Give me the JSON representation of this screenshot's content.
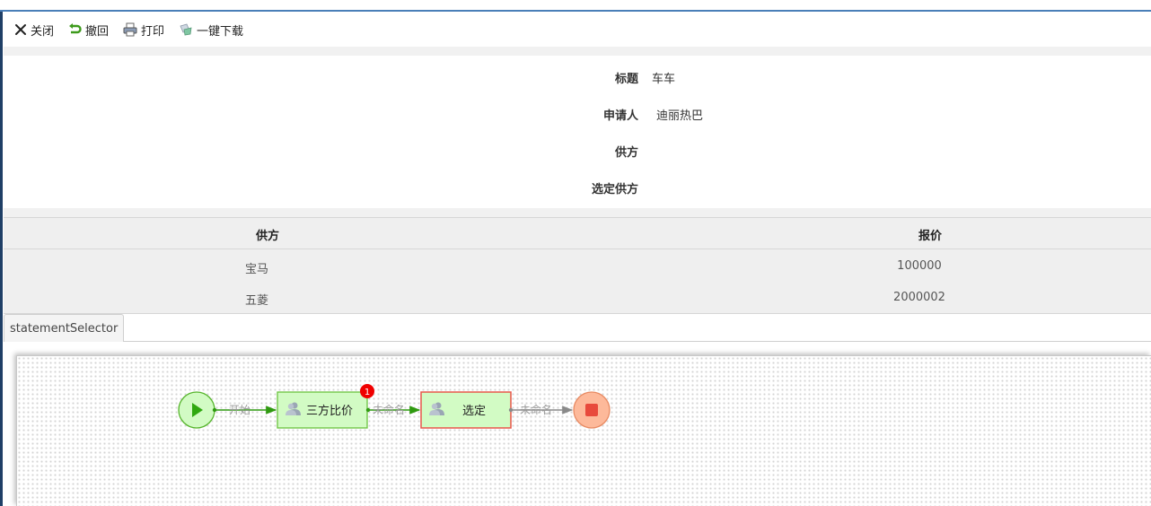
{
  "toolbar": {
    "close_label": "关闭",
    "withdraw_label": "撤回",
    "print_label": "打印",
    "download_label": "一键下载"
  },
  "form": {
    "fields": [
      {
        "label": "标题",
        "value": "车车"
      },
      {
        "label": "申请人",
        "value": "迪丽热巴"
      },
      {
        "label": "供方",
        "value": ""
      },
      {
        "label": "选定供方",
        "value": ""
      }
    ]
  },
  "table": {
    "headers": [
      "供方",
      "报价"
    ],
    "rows": [
      [
        "宝马",
        "100000"
      ],
      [
        "五菱",
        "2000002"
      ]
    ]
  },
  "tab": {
    "label": "statementSelector"
  },
  "flow": {
    "edge1_label": "开始",
    "task1_label": "三方比价",
    "task1_badge": "1",
    "edge2_label": "未命名",
    "task2_label": "选定",
    "edge3_label": "未命名"
  },
  "colors": {
    "accent_line": "#4a7fb8",
    "active_green": "#2f9a10",
    "task_fill": "#d2fbc4",
    "current_border": "#e8574a",
    "end_fill": "#fdb99a",
    "badge": "#f00000"
  }
}
